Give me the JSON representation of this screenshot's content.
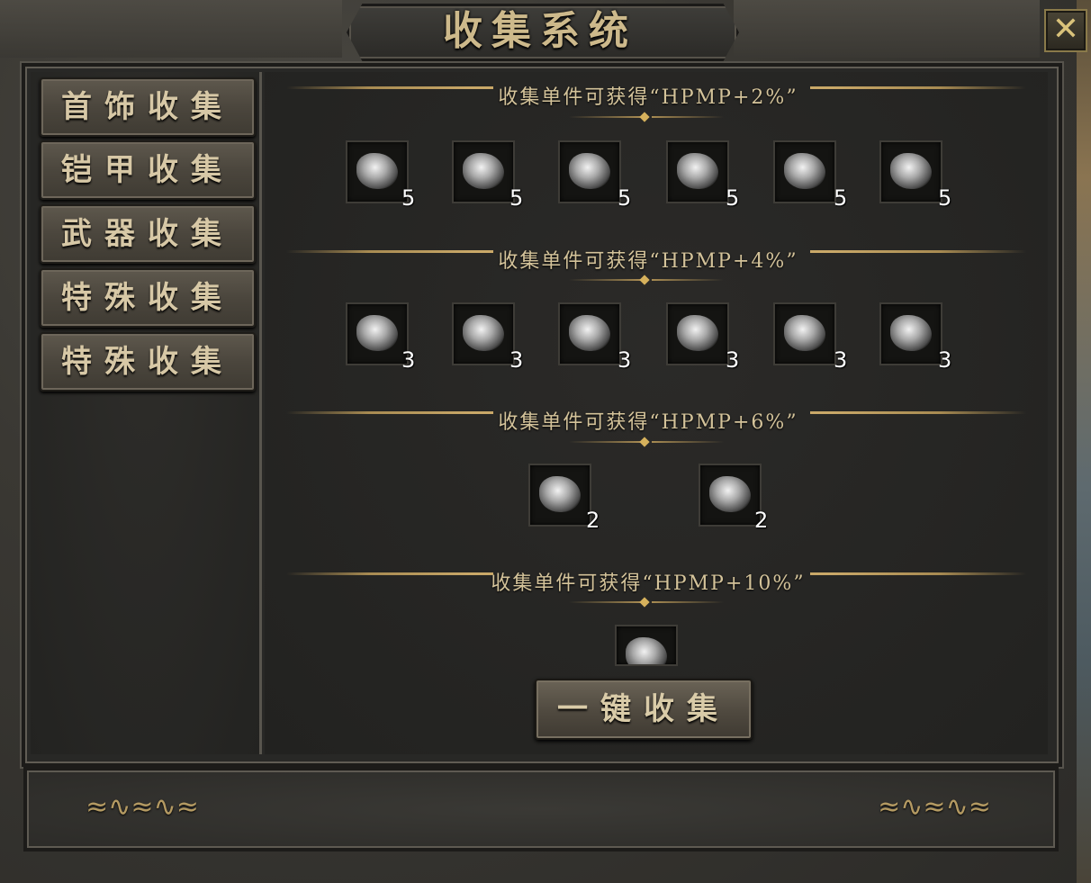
{
  "window": {
    "title": "收集系统",
    "close_glyph": "✕"
  },
  "sidebar": {
    "items": [
      {
        "label": "首饰收集"
      },
      {
        "label": "铠甲收集"
      },
      {
        "label": "武器收集"
      },
      {
        "label": "特殊收集"
      },
      {
        "label": "特殊收集"
      }
    ]
  },
  "sections": [
    {
      "title": "收集单件可获得“HPMP+2%”",
      "counts": [
        "5",
        "5",
        "5",
        "5",
        "5",
        "5"
      ]
    },
    {
      "title": "收集单件可获得“HPMP+4%”",
      "counts": [
        "3",
        "3",
        "3",
        "3",
        "3",
        "3"
      ]
    },
    {
      "title": "收集单件可获得“HPMP+6%”",
      "counts": [
        "2",
        "2"
      ]
    },
    {
      "title": "收集单件可获得“HPMP+10%”",
      "counts": [
        ""
      ]
    }
  ],
  "actions": {
    "collect_all": "一键收集"
  },
  "icons": {
    "item": "equipment-item-icon",
    "dragon": "dragon-ornament-icon",
    "close": "close-icon"
  },
  "colors": {
    "gold": "#c9a868",
    "panel": "#2b2a28",
    "text": "#d4c39a"
  }
}
